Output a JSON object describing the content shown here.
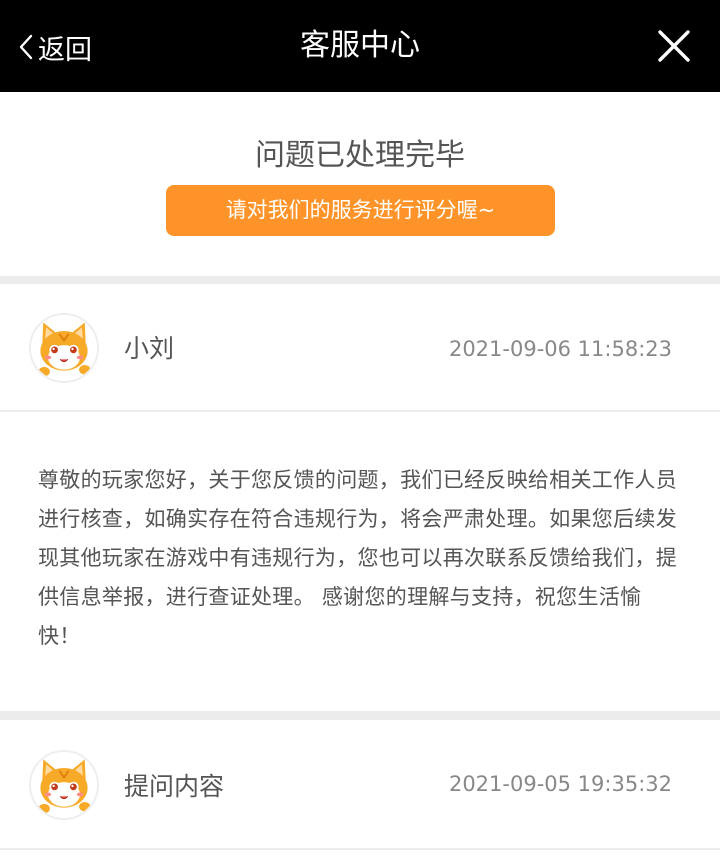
{
  "header": {
    "back_label": "返回",
    "title": "客服中心",
    "close_icon": "close-icon"
  },
  "status": {
    "text": "问题已处理完毕",
    "rate_button_label": "请对我们的服务进行评分喔~",
    "accent_color": "#fe9429"
  },
  "reply": {
    "avatar_icon": "cat-avatar-icon",
    "name": "小刘",
    "time": "2021-09-06 11:58:23",
    "message": "尊敬的玩家您好，关于您反馈的问题，我们已经反映给相关工作人员进行核查，如确实存在符合违规行为，将会严肃处理。如果您后续发现其他玩家在游戏中有违规行为，您也可以再次联系反馈给我们，提供信息举报，进行查证处理。 感谢您的理解与支持，祝您生活愉快！"
  },
  "question": {
    "avatar_icon": "cat-avatar-icon",
    "label": "提问内容",
    "time": "2021-09-05 19:35:32"
  }
}
